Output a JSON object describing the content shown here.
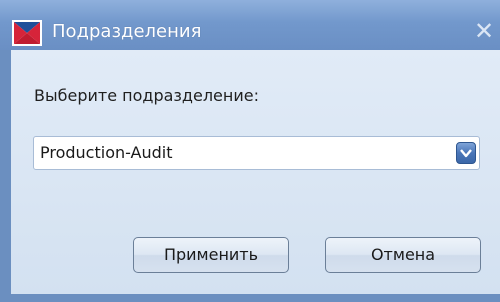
{
  "window": {
    "title": "Подразделения",
    "close_glyph": "✕"
  },
  "dialog": {
    "prompt": "Выберите подразделение:",
    "selected_subdivision": "Production-Audit",
    "apply_label": "Применить",
    "cancel_label": "Отмена"
  },
  "icons": {
    "app": "envelope-logo-icon",
    "dropdown": "chevron-down-icon"
  },
  "colors": {
    "titlebar": "#7298cc",
    "client_background": "#dde8f5",
    "logo_red": "#d6243a",
    "dropdown_button": "#4a76b8"
  }
}
